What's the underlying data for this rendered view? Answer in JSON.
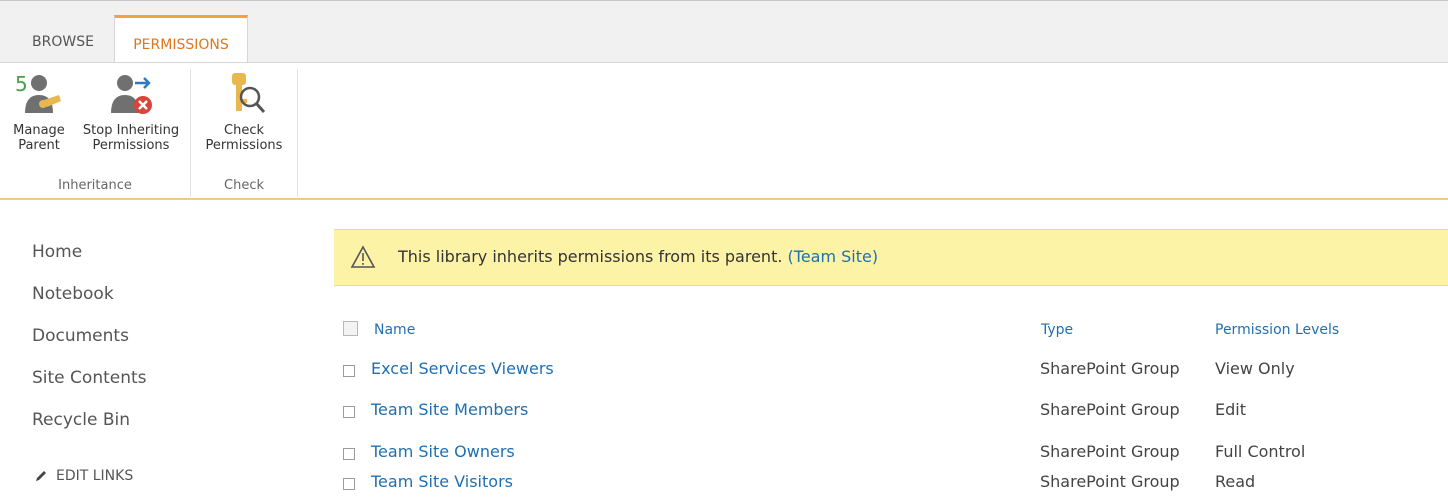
{
  "ribbon_tabs": [
    {
      "label": "BROWSE"
    },
    {
      "label": "PERMISSIONS"
    }
  ],
  "ribbon_groups": {
    "inheritance": {
      "label": "Inheritance",
      "buttons": [
        {
          "line1": "Manage",
          "line2": "Parent",
          "icon": "manage-parent-icon"
        },
        {
          "line1": "Stop Inheriting",
          "line2": "Permissions",
          "icon": "stop-inheriting-icon"
        }
      ]
    },
    "check": {
      "label": "Check",
      "buttons": [
        {
          "line1": "Check",
          "line2": "Permissions",
          "icon": "check-permissions-icon"
        }
      ]
    }
  },
  "nav": {
    "items": [
      "Home",
      "Notebook",
      "Documents",
      "Site Contents",
      "Recycle Bin"
    ],
    "edit_links": "EDIT LINKS"
  },
  "banner": {
    "text": "This library inherits permissions from its parent.",
    "link": "(Team Site)",
    "icon": "warning-icon"
  },
  "table": {
    "headers": {
      "name": "Name",
      "type": "Type",
      "permission": "Permission Levels"
    },
    "rows": [
      {
        "name": "Excel Services Viewers",
        "type": "SharePoint Group",
        "permission": "View Only"
      },
      {
        "name": "Team Site Members",
        "type": "SharePoint Group",
        "permission": "Edit"
      },
      {
        "name": "Team Site Owners",
        "type": "SharePoint Group",
        "permission": "Full Control"
      },
      {
        "name": "Team Site Visitors",
        "type": "SharePoint Group",
        "permission": "Read"
      }
    ]
  },
  "colors": {
    "accent": "#f1a43a",
    "link": "#1f6fb1",
    "banner_bg": "#fdf3a6"
  }
}
